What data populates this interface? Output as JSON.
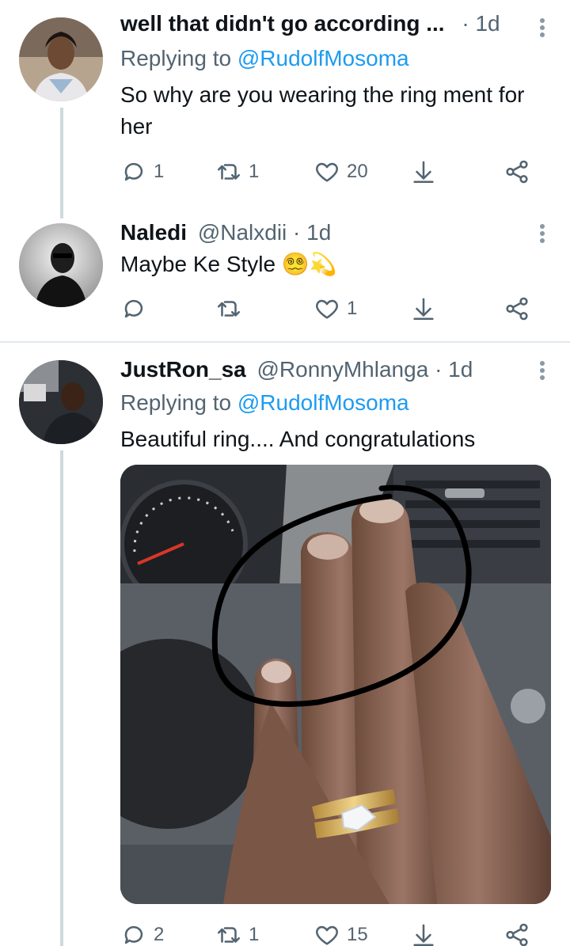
{
  "tweets": [
    {
      "name": "well that didn't go according ...",
      "handle": "",
      "time": "· 1d",
      "replying_to_prefix": "Replying to ",
      "replying_to": "@RudolfMosoma",
      "text": "So why are you wearing the ring ment for her",
      "replies": "1",
      "retweets": "1",
      "likes": "20"
    },
    {
      "name": "Naledi",
      "handle": "@Nalxdii",
      "time": "· 1d",
      "text": "Maybe Ke Style 😵‍💫💫",
      "replies": "",
      "retweets": "",
      "likes": "1"
    },
    {
      "name": "JustRon_sa",
      "handle": "@RonnyMhlanga",
      "time": "· 1d",
      "replying_to_prefix": "Replying to ",
      "replying_to": "@RudolfMosoma",
      "text": "Beautiful ring.... And congratulations",
      "replies": "2",
      "retweets": "1",
      "likes": "15"
    }
  ],
  "colors": {
    "link": "#1d9bf0",
    "secondary_text": "#536471",
    "thread_line": "#cfd9de",
    "separator": "#e1e8ed"
  },
  "icons": [
    "reply-icon",
    "retweet-icon",
    "like-icon",
    "share-icon",
    "more-icon"
  ]
}
